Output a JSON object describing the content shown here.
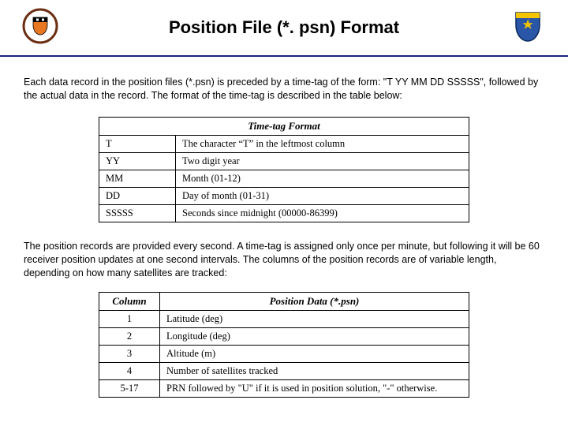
{
  "header": {
    "title": "Position File (*. psn) Format"
  },
  "paragraphs": {
    "p1": "Each data record in the position files (*.psn) is preceded by a time-tag of the form: \"T YY MM DD SSSSS\", followed by the actual data in the record. The format of the time-tag is described in the table below:",
    "p2": "The position records are provided every second. A time-tag is assigned only once per minute, but following it will be 60 receiver position updates at one second intervals. The columns of the position records are of variable length, depending on how many satellites are tracked:"
  },
  "table1": {
    "header": "Time-tag Format",
    "rows": [
      {
        "c1": "T",
        "c2": "The character “T” in the leftmost column"
      },
      {
        "c1": "YY",
        "c2": "Two digit year"
      },
      {
        "c1": "MM",
        "c2": "Month (01-12)"
      },
      {
        "c1": "DD",
        "c2": "Day of month (01-31)"
      },
      {
        "c1": "SSSSS",
        "c2": "Seconds since midnight (00000-86399)"
      }
    ]
  },
  "table2": {
    "header_c1": "Column",
    "header_c2": "Position Data (*.psn)",
    "rows": [
      {
        "c1": "1",
        "c2": "Latitude (deg)"
      },
      {
        "c1": "2",
        "c2": "Longitude (deg)"
      },
      {
        "c1": "3",
        "c2": "Altitude (m)"
      },
      {
        "c1": "4",
        "c2": "Number of satellites tracked"
      },
      {
        "c1": "5-17",
        "c2": "PRN followed by \"U\" if it is used in position solution, \"-\" otherwise."
      }
    ]
  }
}
